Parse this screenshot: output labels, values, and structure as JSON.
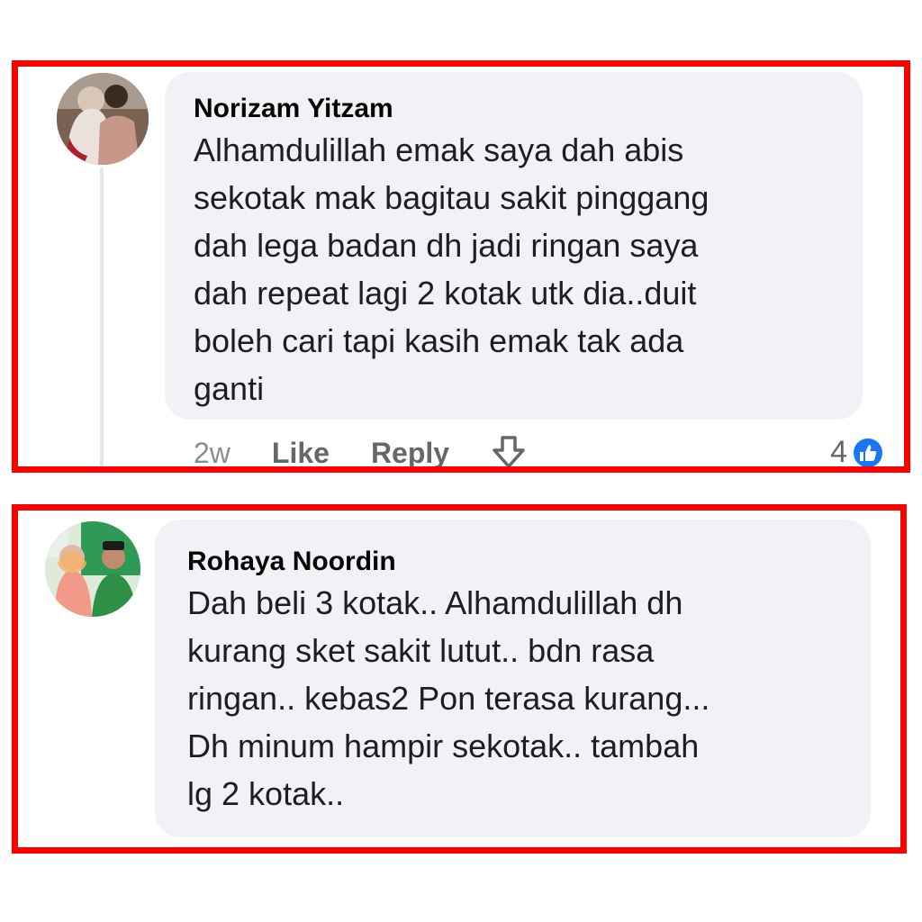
{
  "comments": [
    {
      "author": "Norizam Yitzam",
      "lines": [
        "Alhamdulillah emak saya dah abis",
        "sekotak mak bagitau sakit pinggang",
        "dah lega badan dh jadi ringan saya",
        "dah repeat lagi 2 kotak utk dia..duit",
        "boleh cari tapi kasih emak tak ada",
        "ganti"
      ],
      "time": "2w",
      "like_label": "Like",
      "reply_label": "Reply",
      "reaction_count": "4",
      "reaction_icon": "thumbs-up-icon"
    },
    {
      "author": "Rohaya Noordin",
      "lines": [
        "Dah beli 3 kotak.. Alhamdulillah dh",
        "kurang sket sakit lutut.. bdn rasa",
        "ringan..  kebas2 Pon terasa kurang...",
        "Dh minum hampir sekotak.. tambah",
        "lg 2 kotak.."
      ]
    }
  ],
  "colors": {
    "highlight_border": "#ff0000",
    "bubble_bg": "#f0f2f5",
    "like_blue": "#1877f2",
    "meta_gray": "#65676b"
  }
}
